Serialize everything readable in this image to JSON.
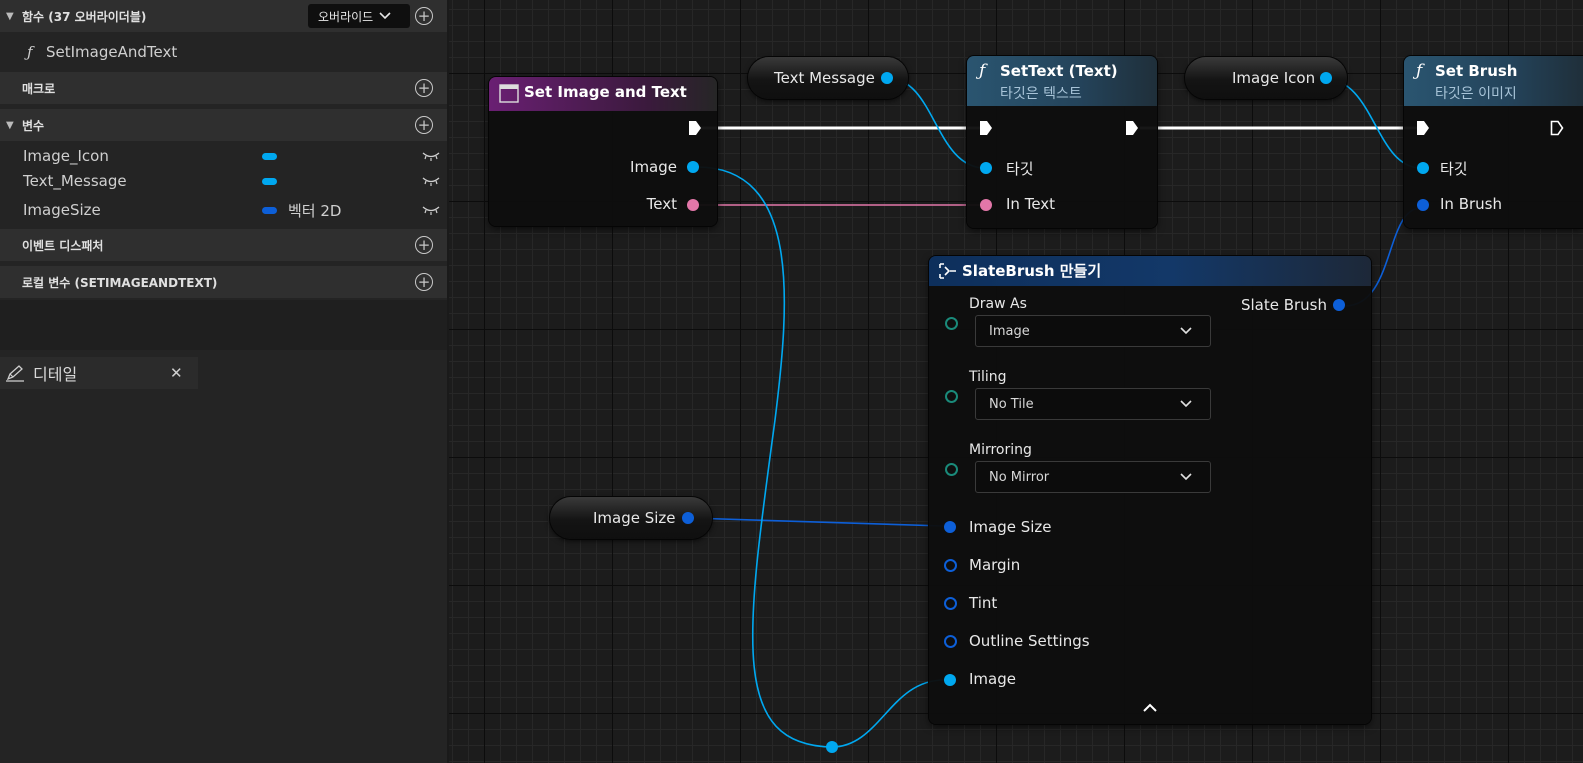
{
  "left_panel": {
    "functions": {
      "title": "함수 (37 오버라이더블)",
      "override_label": "오버라이드",
      "items": [
        {
          "label": "SetImageAndText"
        }
      ]
    },
    "macros": {
      "title": "매크로"
    },
    "variables": {
      "title": "변수",
      "items": [
        {
          "name": "Image_Icon",
          "type": "",
          "color": "#00a8f0"
        },
        {
          "name": "Text_Message",
          "type": "",
          "color": "#00a8f0"
        },
        {
          "name": "ImageSize",
          "type": "벡터 2D",
          "color": "#0d5fd8"
        }
      ]
    },
    "event_dispatchers": {
      "title": "이벤트 디스패처"
    },
    "local_variables": {
      "title": "로컬 변수 (SETIMAGEANDTEXT)"
    },
    "details_tab": {
      "label": "디테일"
    }
  },
  "graph": {
    "nodes": {
      "set_image_and_text": {
        "title": "Set Image and Text",
        "pins": {
          "image": "Image",
          "text": "Text"
        }
      },
      "text_message_var": {
        "label": "Text Message"
      },
      "set_text": {
        "title": "SetText (Text)",
        "subtitle": "타깃은 텍스트",
        "pins": {
          "target": "타깃",
          "in_text": "In Text"
        }
      },
      "image_icon_var": {
        "label": "Image Icon"
      },
      "set_brush": {
        "title": "Set Brush",
        "subtitle": "타깃은 이미지",
        "pins": {
          "target": "타깃",
          "in_brush": "In Brush"
        }
      },
      "make_slate_brush": {
        "title": "SlateBrush 만들기",
        "output": "Slate Brush",
        "draw_as": {
          "label": "Draw As",
          "value": "Image"
        },
        "tiling": {
          "label": "Tiling",
          "value": "No Tile"
        },
        "mirroring": {
          "label": "Mirroring",
          "value": "No Mirror"
        },
        "pins": {
          "image_size": "Image Size",
          "margin": "Margin",
          "tint": "Tint",
          "outline": "Outline Settings",
          "image": "Image"
        }
      },
      "image_size_var": {
        "label": "Image Size"
      }
    },
    "colors": {
      "object_pin": "#00a8f0",
      "struct_pin": "#0d5fd8",
      "text_pin": "#e377a9",
      "exec_wire": "#ffffff",
      "function_header": "#2a5570",
      "event_header": "#6a1f73"
    }
  }
}
